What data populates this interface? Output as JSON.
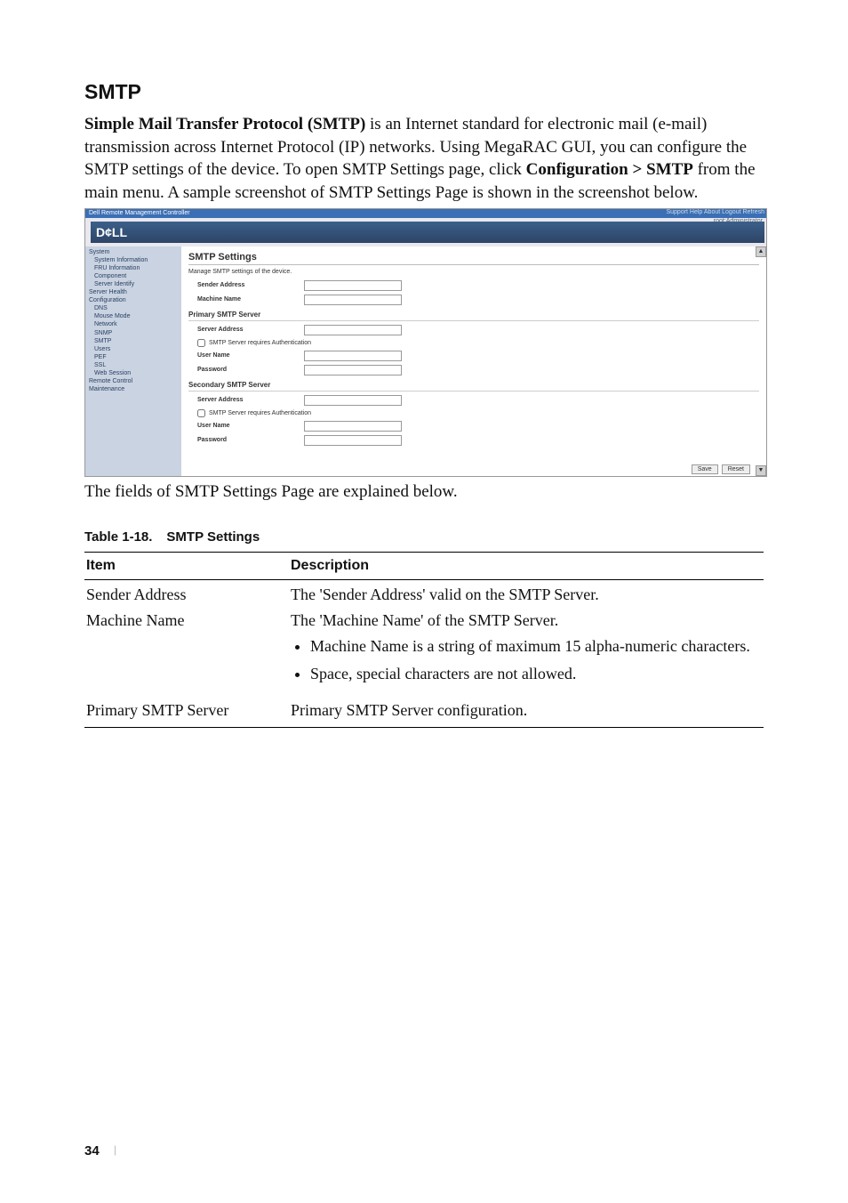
{
  "section_title": "SMTP",
  "paragraph": {
    "lead_bold": "Simple Mail Transfer Protocol (SMTP)",
    "rest": " is an Internet standard for electronic mail (e-mail) transmission across Internet Protocol (IP) networks. Using MegaRAC GUI, you can configure the SMTP settings of the device. To open SMTP Settings page, click ",
    "nav_bold": "Configuration > SMTP",
    "tail": " from the main menu. A sample screenshot of SMTP Settings Page is shown in the screenshot below."
  },
  "screenshot": {
    "titlebar": "Dell Remote Management Controller",
    "toplinks": "Support  Help  About  Logout  Refresh",
    "subuser": "root:Administrator",
    "logo": "D¢LL",
    "nav": {
      "items": [
        "System",
        "System Information",
        "FRU Information",
        "Component",
        "Server Identify",
        "Server Health",
        "Configuration",
        "DNS",
        "Mouse Mode",
        "Network",
        "SNMP",
        "SMTP",
        "Users",
        "PEF",
        "SSL",
        "Web Session",
        "Remote Control",
        "Maintenance"
      ]
    },
    "main": {
      "h1": "SMTP Settings",
      "desc": "Manage SMTP settings of the device.",
      "sender_label": "Sender Address",
      "machine_label": "Machine Name",
      "primary_hdr": "Primary SMTP Server",
      "server_label": "Server Address",
      "auth_label": "SMTP Server requires Authentication",
      "user_label": "User Name",
      "pass_label": "Password",
      "secondary_hdr": "Secondary SMTP Server",
      "btn_save": "Save",
      "btn_reset": "Reset"
    }
  },
  "under_ss": "The fields of SMTP Settings Page are explained below.",
  "table": {
    "caption_num": "Table 1-18.",
    "caption_title": "SMTP Settings",
    "head_item": "Item",
    "head_desc": "Description",
    "rows": {
      "r1_item": "Sender Address",
      "r1_desc": "The 'Sender Address' valid on the SMTP Server.",
      "r2_item": "Machine Name",
      "r2_desc": "The 'Machine Name' of the SMTP Server.",
      "r2_b1": "Machine Name is a string of maximum 15 alpha-numeric characters.",
      "r2_b2": "Space, special characters are not allowed.",
      "r3_item": "Primary SMTP Server",
      "r3_desc": "Primary SMTP Server configuration."
    }
  },
  "page_number": "34",
  "page_bar": "|"
}
